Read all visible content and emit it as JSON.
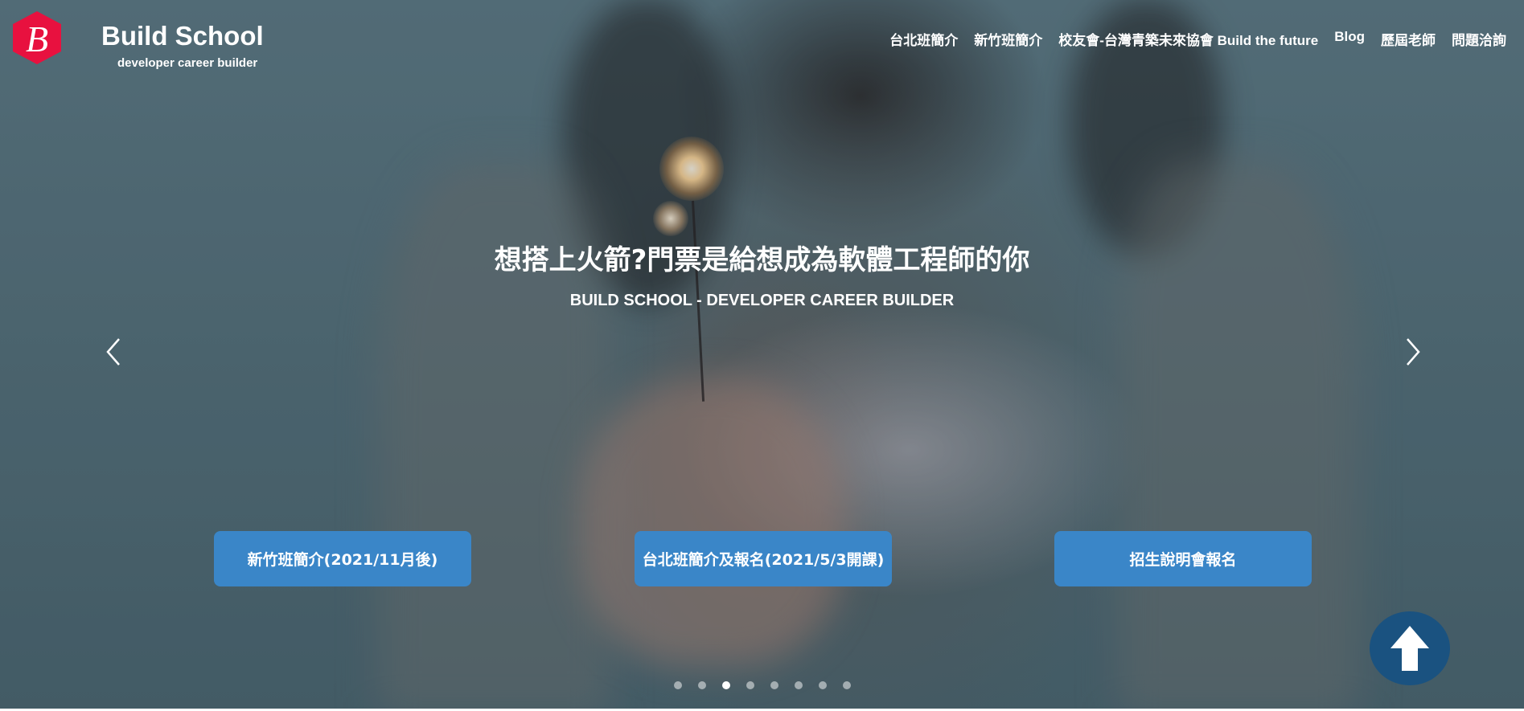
{
  "brand": {
    "logo_letter": "B",
    "name": "Build School",
    "tagline": "developer career builder",
    "logo_color": "#e8113f"
  },
  "nav": {
    "items": [
      {
        "label": "台北班簡介"
      },
      {
        "label": "新竹班簡介"
      },
      {
        "label": "校友會-台灣青築未來協會 Build the future"
      },
      {
        "label": "Blog"
      },
      {
        "label": "歷屆老師"
      },
      {
        "label": "問題洽詢"
      }
    ]
  },
  "hero": {
    "headline": "想搭上火箭?門票是給想成為軟體工程師的你",
    "subheadline": "BUILD SCHOOL - DEVELOPER CAREER BUILDER",
    "prev_icon": "chevron-left-icon",
    "next_icon": "chevron-right-icon"
  },
  "cta": {
    "buttons": [
      {
        "label": "新竹班簡介(2021/11月後)"
      },
      {
        "label": "台北班簡介及報名(2021/5/3開課)"
      },
      {
        "label": "招生說明會報名"
      }
    ],
    "color": "#3a86c8"
  },
  "carousel": {
    "slide_count": 8,
    "active_index": 3
  },
  "back_to_top": {
    "icon": "arrow-up-icon",
    "color": "#1a5280"
  }
}
